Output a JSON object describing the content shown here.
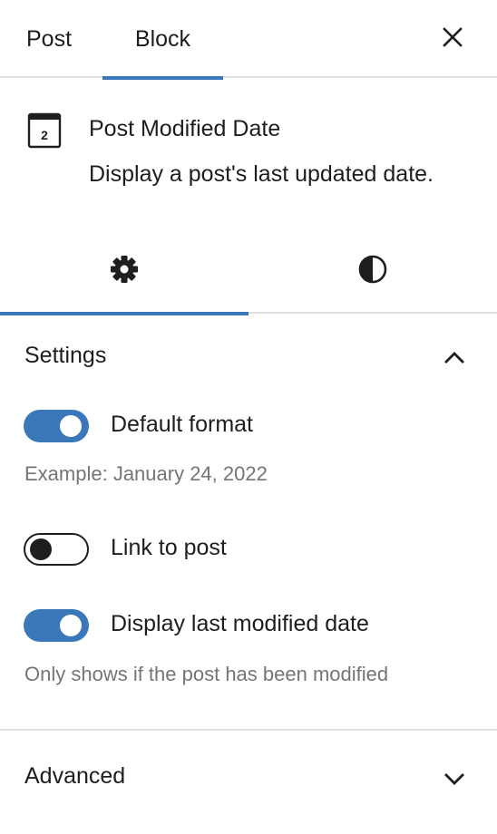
{
  "tabs": {
    "post_label": "Post",
    "block_label": "Block",
    "active": "Block"
  },
  "icons": {
    "close": "close-icon",
    "block": "calendar-icon",
    "settings": "gear-icon",
    "styles": "contrast-icon"
  },
  "block": {
    "icon_number": "2",
    "title": "Post Modified Date",
    "description": "Display a post's last updated date."
  },
  "settings_panel": {
    "title": "Settings",
    "expanded": true,
    "toggles": [
      {
        "label": "Default format",
        "checked": true,
        "help": "Example: January 24, 2022"
      },
      {
        "label": "Link to post",
        "checked": false,
        "help": ""
      },
      {
        "label": "Display last modified date",
        "checked": true,
        "help": "Only shows if the post has been modified"
      }
    ]
  },
  "advanced_panel": {
    "title": "Advanced",
    "expanded": false
  },
  "colors": {
    "accent": "#3a78b9",
    "text": "#1e1e1e",
    "muted": "#757575",
    "divider": "#e0e0e0"
  }
}
